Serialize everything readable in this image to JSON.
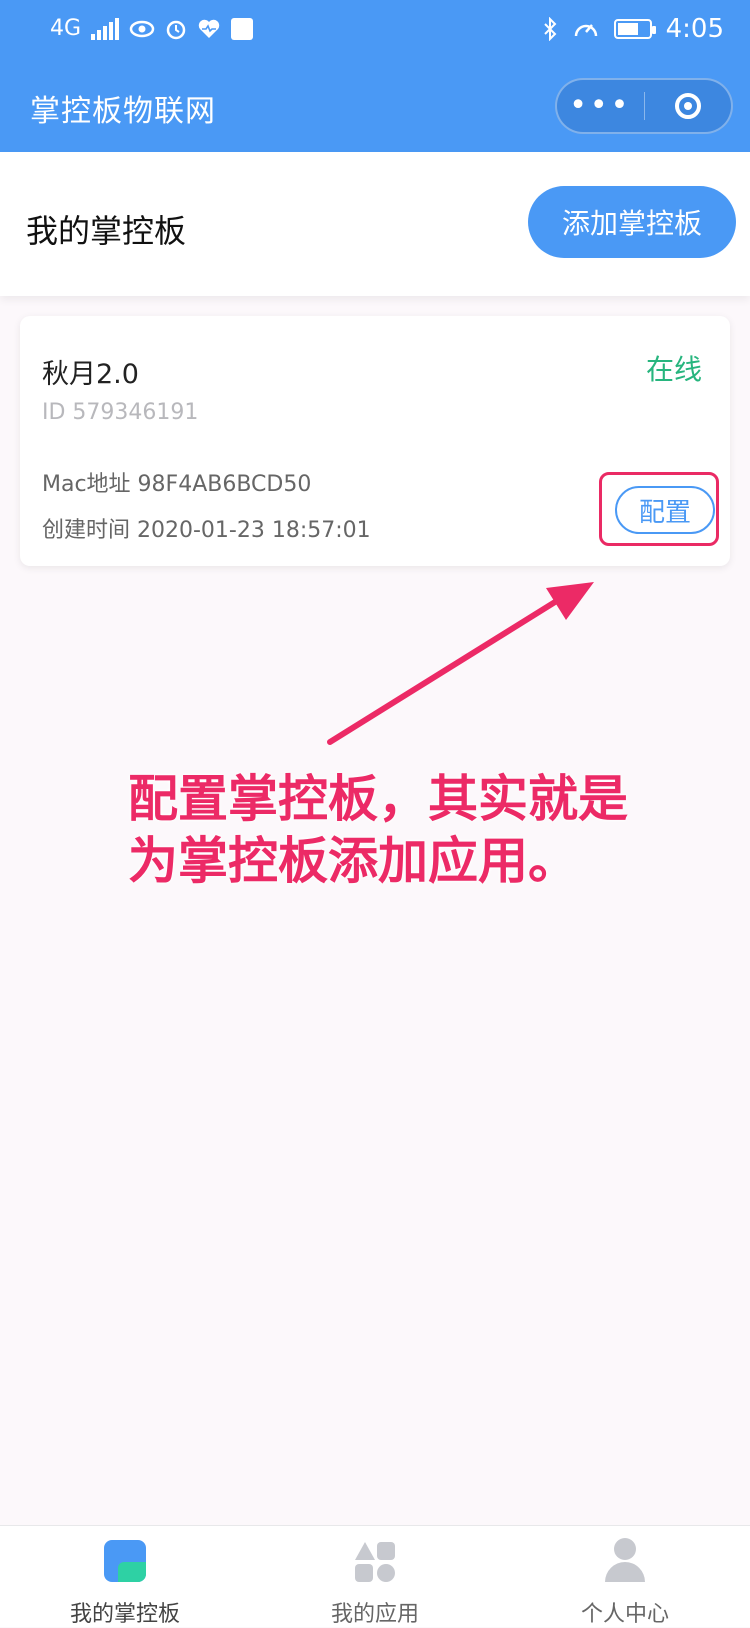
{
  "status_bar": {
    "network": "4G",
    "time": "4:05"
  },
  "header": {
    "title": "掌控板物联网",
    "more_label": "•••"
  },
  "subheader": {
    "title": "我的掌控板",
    "add_button": "添加掌控板"
  },
  "device": {
    "name": "秋月2.0",
    "id": "ID 579346191",
    "status": "在线",
    "mac": "Mac地址 98F4AB6BCD50",
    "created": "创建时间 2020-01-23 18:57:01",
    "config_button": "配置"
  },
  "annotation": {
    "line1": "配置掌控板，其实就是",
    "line2": "为掌控板添加应用。",
    "color": "#ec2a66"
  },
  "tabs": [
    {
      "label": "我的掌控板",
      "icon": "board-icon",
      "active": true
    },
    {
      "label": "我的应用",
      "icon": "apps-icon",
      "active": false
    },
    {
      "label": "个人中心",
      "icon": "user-icon",
      "active": false
    }
  ],
  "colors": {
    "primary": "#4a99f5",
    "online": "#27b57e",
    "annotation": "#ec2a66"
  }
}
